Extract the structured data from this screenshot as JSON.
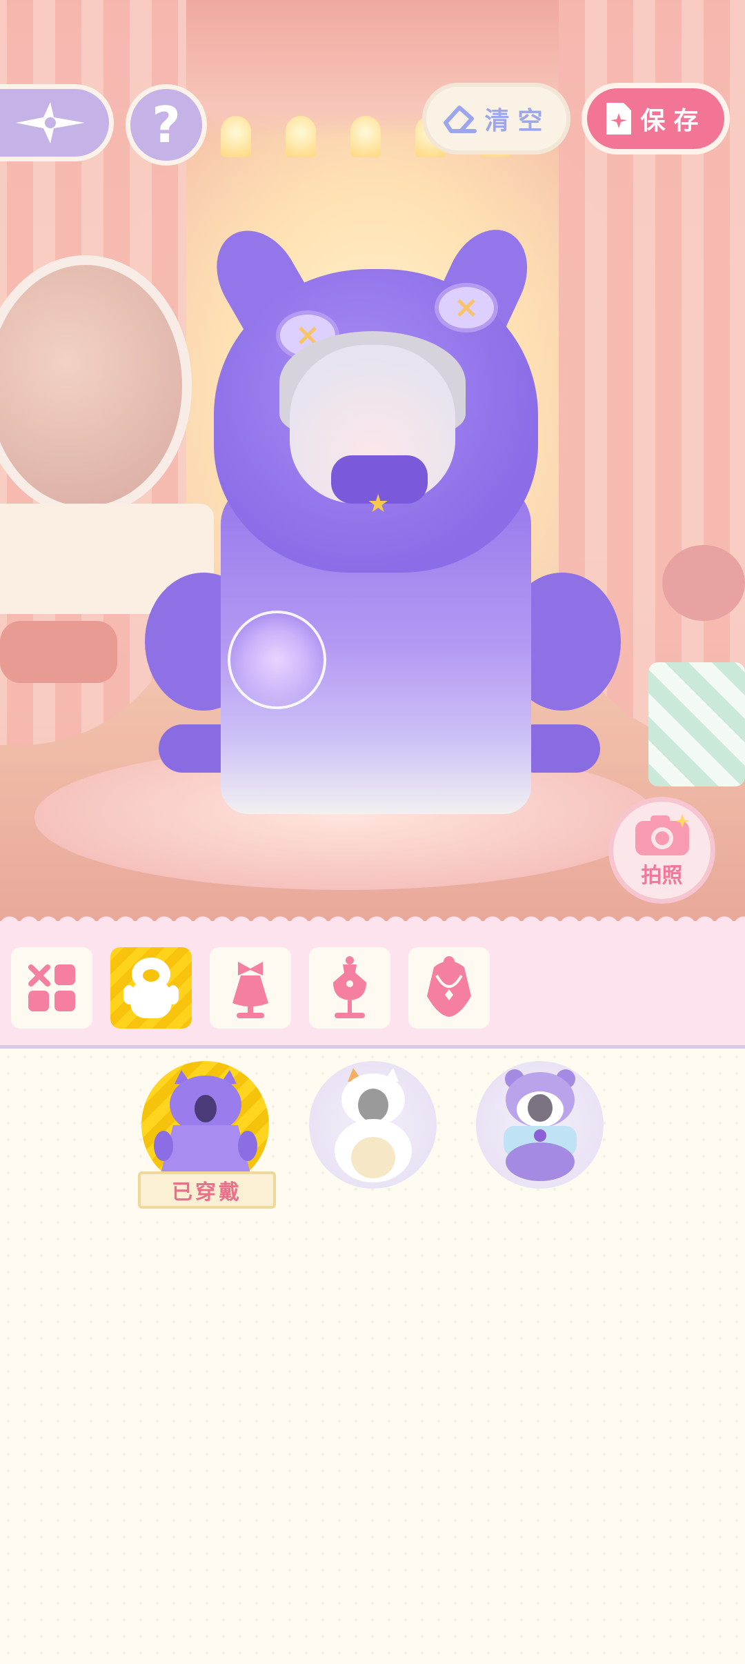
{
  "toolbar": {
    "clear_label": "清空",
    "save_label": "保存",
    "photo_label": "拍照"
  },
  "categories": [
    {
      "icon": "grid-x-icon",
      "selected": false
    },
    {
      "icon": "onesie-icon",
      "selected": true
    },
    {
      "icon": "bow-dress-icon",
      "selected": false
    },
    {
      "icon": "dress-form-icon",
      "selected": false
    },
    {
      "icon": "necklace-icon",
      "selected": false
    }
  ],
  "items": [
    {
      "icon": "purple-cat-hoodie-icon",
      "equipped": true
    },
    {
      "icon": "white-cat-costume-icon",
      "equipped": false
    },
    {
      "icon": "purple-hamster-costume-icon",
      "equipped": false
    }
  ],
  "equipped_label": "已穿戴",
  "colors": {
    "accent_pink": "#f37596",
    "clear_blue": "#9ba6ee",
    "tab_bg": "#fde3ee",
    "selected_yellow": "#ffd21b",
    "hud_purple": "#c5b2e6"
  }
}
